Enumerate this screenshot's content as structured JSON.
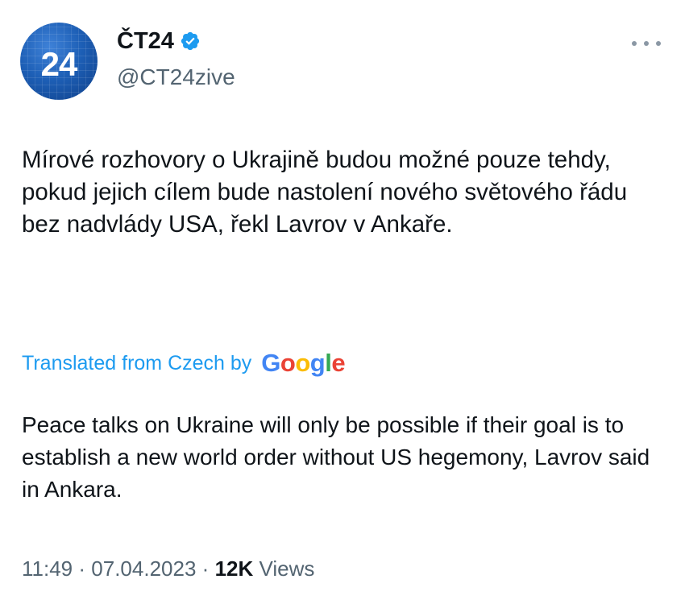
{
  "account": {
    "avatar_text": "24",
    "display_name": "ČT24",
    "handle": "@CT24zive",
    "verified_color": "#1d9bf0"
  },
  "tweet": {
    "text": "Mírové rozhovory o Ukrajině budou možné pouze tehdy, pokud jejich cílem bude nastolení nového světového řádu bez nadvlády USA, řekl Lavrov v Ankaře.",
    "translated_label": "Translated from Czech by",
    "google_letters": [
      "G",
      "o",
      "o",
      "g",
      "l",
      "e"
    ],
    "translation": "Peace talks on Ukraine will only be possible if their goal is to establish a new world order without US hegemony, Lavrov said in Ankara."
  },
  "meta": {
    "time": "11:49",
    "separator": "·",
    "date": "07.04.2023",
    "views_count": "12K",
    "views_label": "Views"
  },
  "icons": {
    "avatar": "ct24-logo",
    "verified": "verified-badge-icon",
    "more": "more-options-icon"
  }
}
